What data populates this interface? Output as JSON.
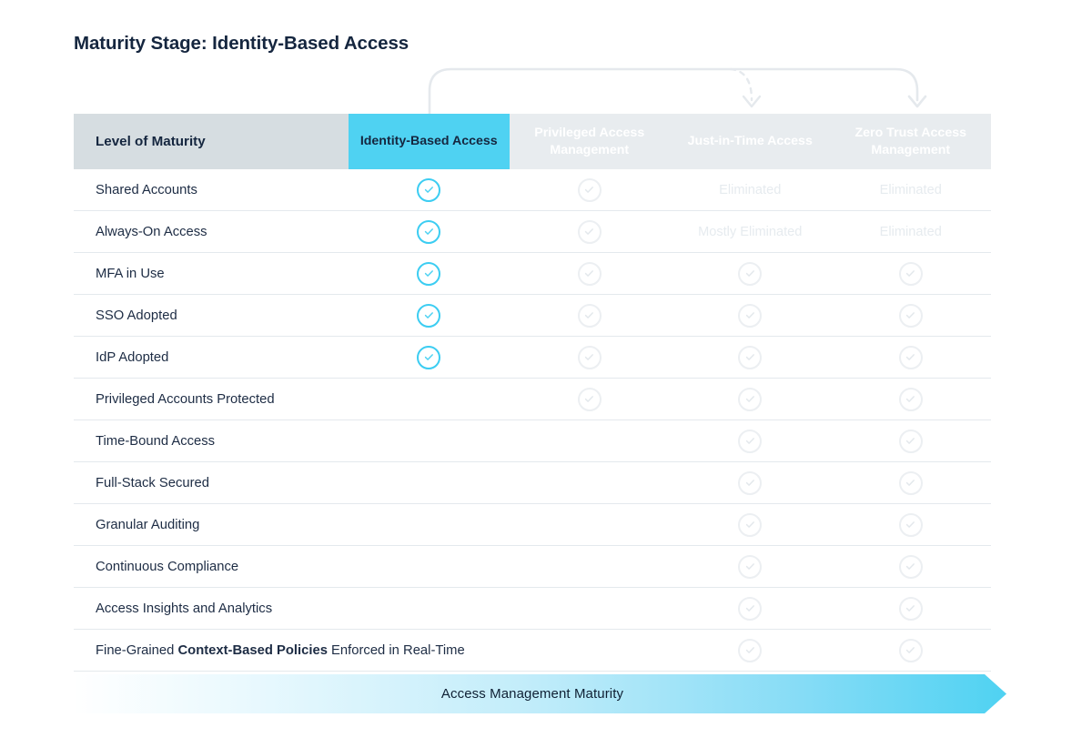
{
  "page": {
    "title": "Maturity Stage: Identity-Based Access"
  },
  "colors": {
    "accent_cyan": "#4fd2f2",
    "header_label_bg": "#d6dde1",
    "header_col_bg": "#e8ecef",
    "text_dark": "#15263f",
    "text_faint": "#e6ebef",
    "row_divider": "#e4e9ed"
  },
  "table": {
    "label_header": "Level of Maturity",
    "columns": [
      {
        "label": "Identity-Based Access",
        "active": true
      },
      {
        "label": "Privileged Access Management",
        "active": false
      },
      {
        "label": "Just-in-Time Access",
        "active": false
      },
      {
        "label": "Zero Trust Access Management",
        "active": false
      }
    ],
    "rows": [
      {
        "label": "Shared Accounts",
        "label_html": "Shared Accounts",
        "cells": [
          {
            "type": "check",
            "state": "on"
          },
          {
            "type": "check",
            "state": "off"
          },
          {
            "type": "text",
            "value": "Eliminated"
          },
          {
            "type": "text",
            "value": "Eliminated"
          }
        ]
      },
      {
        "label": "Always-On Access",
        "label_html": "Always-On Access",
        "cells": [
          {
            "type": "check",
            "state": "on"
          },
          {
            "type": "check",
            "state": "off"
          },
          {
            "type": "text",
            "value": "Mostly Eliminated"
          },
          {
            "type": "text",
            "value": "Eliminated"
          }
        ]
      },
      {
        "label": "MFA in Use",
        "label_html": "MFA in Use",
        "cells": [
          {
            "type": "check",
            "state": "on"
          },
          {
            "type": "check",
            "state": "off"
          },
          {
            "type": "check",
            "state": "off"
          },
          {
            "type": "check",
            "state": "off"
          }
        ]
      },
      {
        "label": "SSO Adopted",
        "label_html": "SSO Adopted",
        "cells": [
          {
            "type": "check",
            "state": "on"
          },
          {
            "type": "check",
            "state": "off"
          },
          {
            "type": "check",
            "state": "off"
          },
          {
            "type": "check",
            "state": "off"
          }
        ]
      },
      {
        "label": "IdP Adopted",
        "label_html": "IdP Adopted",
        "cells": [
          {
            "type": "check",
            "state": "on"
          },
          {
            "type": "check",
            "state": "off"
          },
          {
            "type": "check",
            "state": "off"
          },
          {
            "type": "check",
            "state": "off"
          }
        ]
      },
      {
        "label": "Privileged Accounts Protected",
        "label_html": "Privileged Accounts Protected",
        "cells": [
          {
            "type": "empty"
          },
          {
            "type": "check",
            "state": "off"
          },
          {
            "type": "check",
            "state": "off"
          },
          {
            "type": "check",
            "state": "off"
          }
        ]
      },
      {
        "label": "Time-Bound Access",
        "label_html": "Time-Bound Access",
        "cells": [
          {
            "type": "empty"
          },
          {
            "type": "empty"
          },
          {
            "type": "check",
            "state": "off"
          },
          {
            "type": "check",
            "state": "off"
          }
        ]
      },
      {
        "label": "Full-Stack Secured",
        "label_html": "Full-Stack Secured",
        "cells": [
          {
            "type": "empty"
          },
          {
            "type": "empty"
          },
          {
            "type": "check",
            "state": "off"
          },
          {
            "type": "check",
            "state": "off"
          }
        ]
      },
      {
        "label": "Granular Auditing",
        "label_html": "Granular Auditing",
        "cells": [
          {
            "type": "empty"
          },
          {
            "type": "empty"
          },
          {
            "type": "check",
            "state": "off"
          },
          {
            "type": "check",
            "state": "off"
          }
        ]
      },
      {
        "label": "Continuous Compliance",
        "label_html": "Continuous Compliance",
        "cells": [
          {
            "type": "empty"
          },
          {
            "type": "empty"
          },
          {
            "type": "check",
            "state": "off"
          },
          {
            "type": "check",
            "state": "off"
          }
        ]
      },
      {
        "label": "Access Insights and Analytics",
        "label_html": "Access Insights and Analytics",
        "cells": [
          {
            "type": "empty"
          },
          {
            "type": "empty"
          },
          {
            "type": "check",
            "state": "off"
          },
          {
            "type": "check",
            "state": "off"
          }
        ]
      },
      {
        "label": "Fine-Grained Context-Based Policies Enforced in Real-Time",
        "label_html": "Fine-Grained <b>Context-Based Policies</b> Enforced in Real-Time",
        "cells": [
          {
            "type": "empty"
          },
          {
            "type": "empty"
          },
          {
            "type": "check",
            "state": "off"
          },
          {
            "type": "check",
            "state": "off"
          }
        ]
      }
    ]
  },
  "maturity_bar": {
    "label": "Access Management Maturity"
  },
  "arrows": [
    {
      "name": "progression-arrow-solid",
      "style": "solid",
      "from_column": "Identity-Based Access",
      "to_column": "Zero Trust Access Management"
    },
    {
      "name": "progression-arrow-dashed",
      "style": "dashed",
      "from_column": "Identity-Based Access",
      "to_column": "Just-in-Time Access"
    }
  ]
}
